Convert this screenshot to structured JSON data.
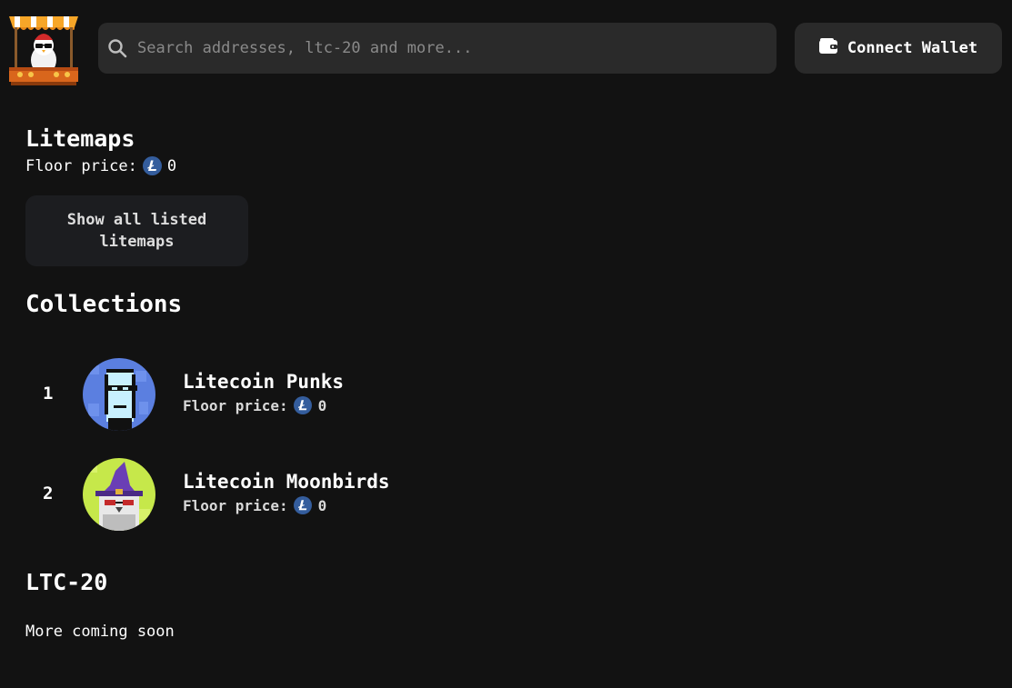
{
  "header": {
    "logo_alt": "market stall mascot logo",
    "search_placeholder": "Search addresses, ltc-20 and more...",
    "connect_label": "Connect Wallet"
  },
  "litemaps": {
    "title": "Litemaps",
    "floor_label": "Floor price:",
    "floor_value": "0",
    "show_all_label": "Show all listed litemaps"
  },
  "collections": {
    "title": "Collections",
    "items": [
      {
        "rank": "1",
        "name": "Litecoin Punks",
        "floor_label": "Floor price:",
        "floor_value": "0"
      },
      {
        "rank": "2",
        "name": "Litecoin Moonbirds",
        "floor_label": "Floor price:",
        "floor_value": "0"
      }
    ]
  },
  "ltc20": {
    "title": "LTC-20",
    "status": "More coming soon"
  },
  "icons": {
    "search": "search-icon",
    "wallet": "wallet-icon",
    "litecoin": "litecoin-icon"
  },
  "colors": {
    "background": "#121212",
    "surface": "#2a2a2a",
    "litecoin_blue": "#345d9d"
  }
}
